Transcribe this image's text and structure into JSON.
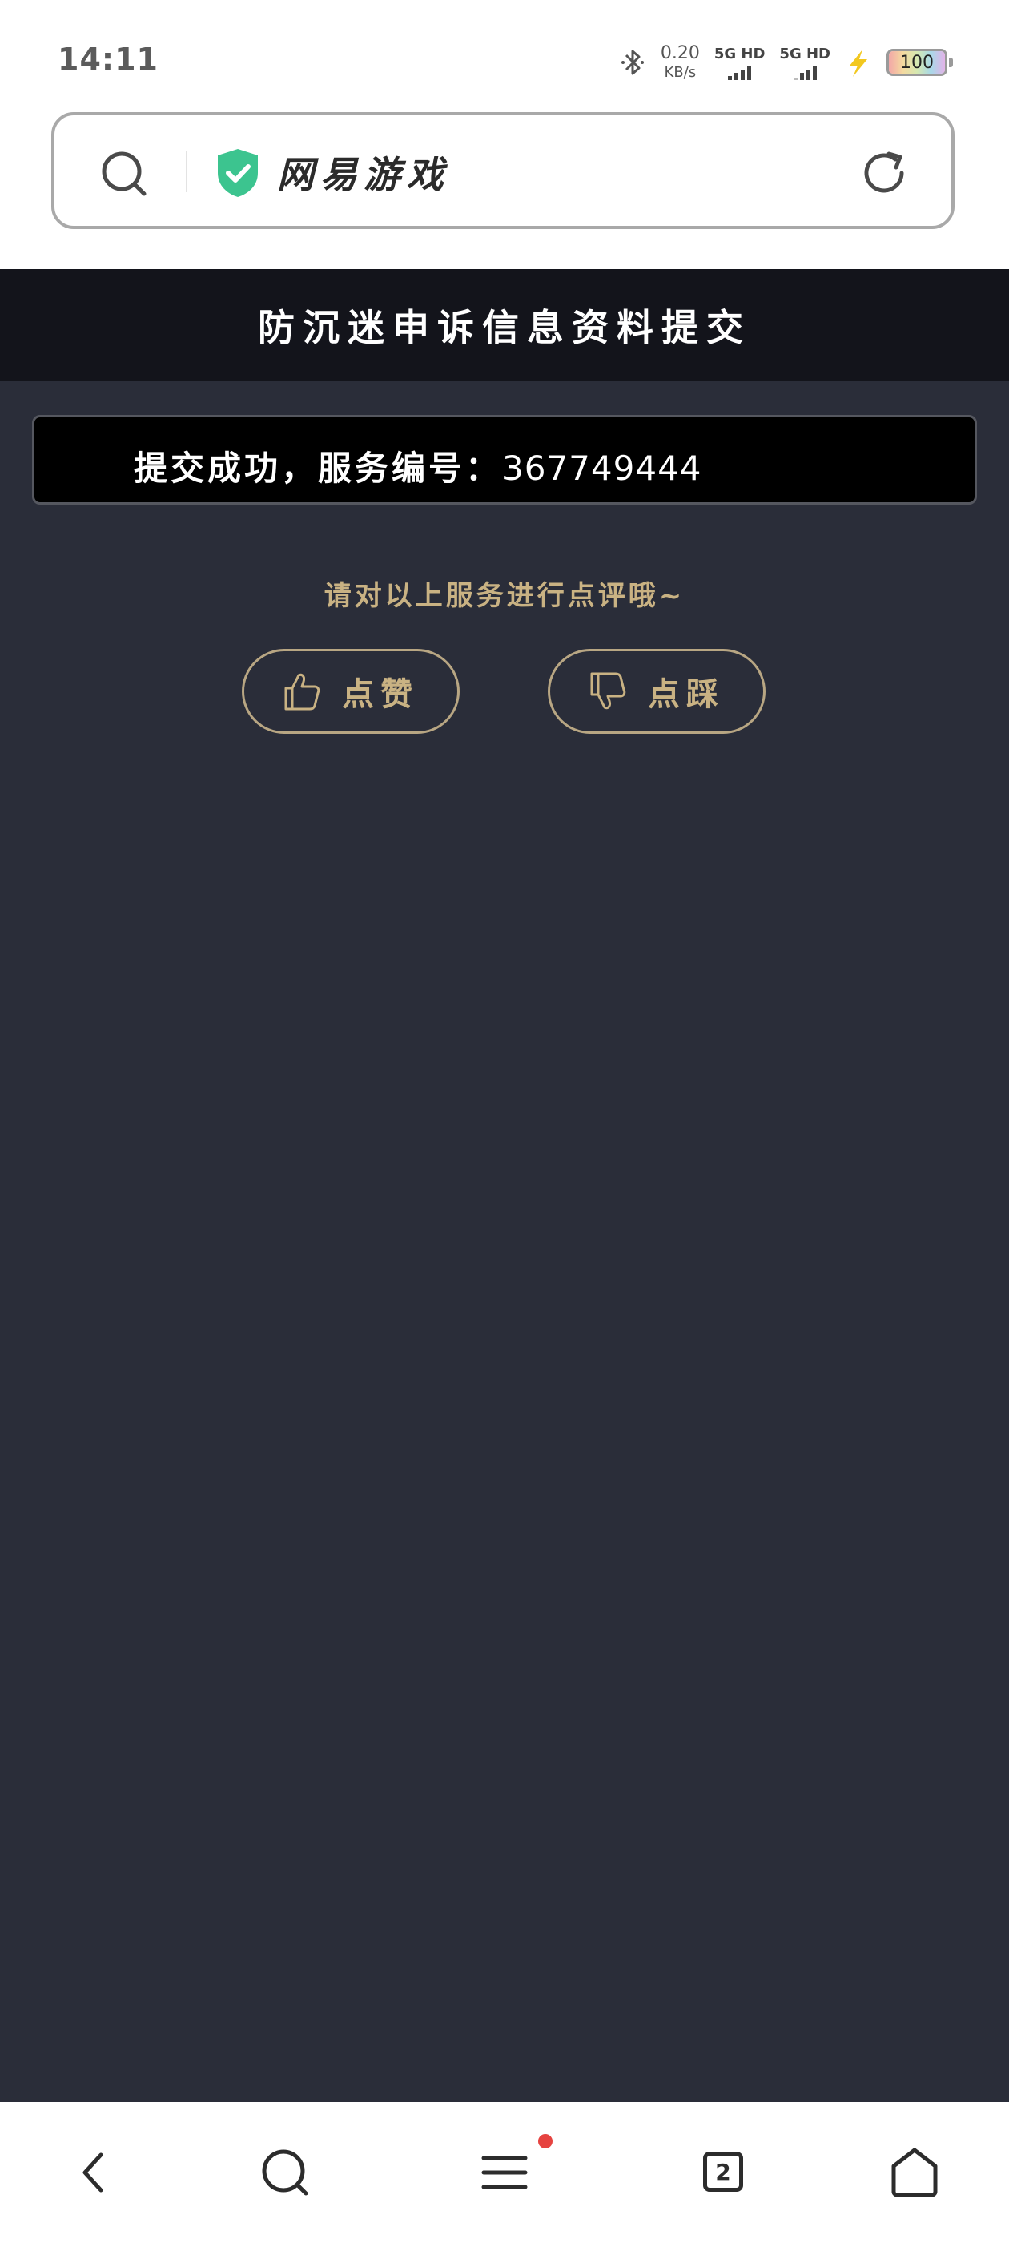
{
  "status_bar": {
    "time": "14:11",
    "net_speed_value": "0.20",
    "net_speed_unit": "KB/s",
    "sim1_label": "5G HD",
    "sim2_label": "5G HD",
    "battery_level": "100",
    "icons": [
      "bluetooth-icon",
      "charging-bolt-icon",
      "battery-icon"
    ]
  },
  "address_bar": {
    "site_title": "网易游戏",
    "verified_color": "#3cc48f",
    "icons": [
      "search-icon",
      "verified-shield-icon",
      "refresh-icon"
    ]
  },
  "page": {
    "title": "防沉迷申诉信息资料提交",
    "success_label": "提交成功，服务编号：",
    "service_number": "367749444",
    "rate_prompt": "请对以上服务进行点评哦~",
    "like_label": "点赞",
    "dislike_label": "点踩",
    "accent_color": "#c9b283",
    "background_color": "#2a2d39"
  },
  "bottom_nav": {
    "tab_count": "2",
    "has_menu_notification": true,
    "icons": [
      "back-icon",
      "search-icon",
      "menu-icon",
      "tabs-icon",
      "home-icon"
    ]
  }
}
